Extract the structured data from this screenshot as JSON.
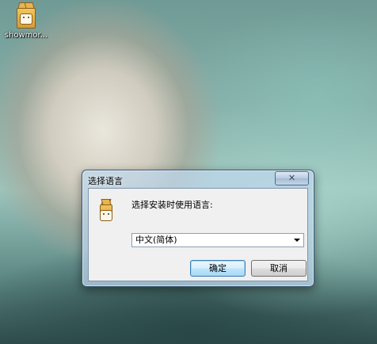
{
  "desktop": {
    "icon_label": "showmor..."
  },
  "dialog": {
    "title": "选择语言",
    "close_label": "✕",
    "prompt": "选择安装时使用语言:",
    "language_selected": "中文(简体)",
    "ok_label": "确定",
    "cancel_label": "取消"
  }
}
